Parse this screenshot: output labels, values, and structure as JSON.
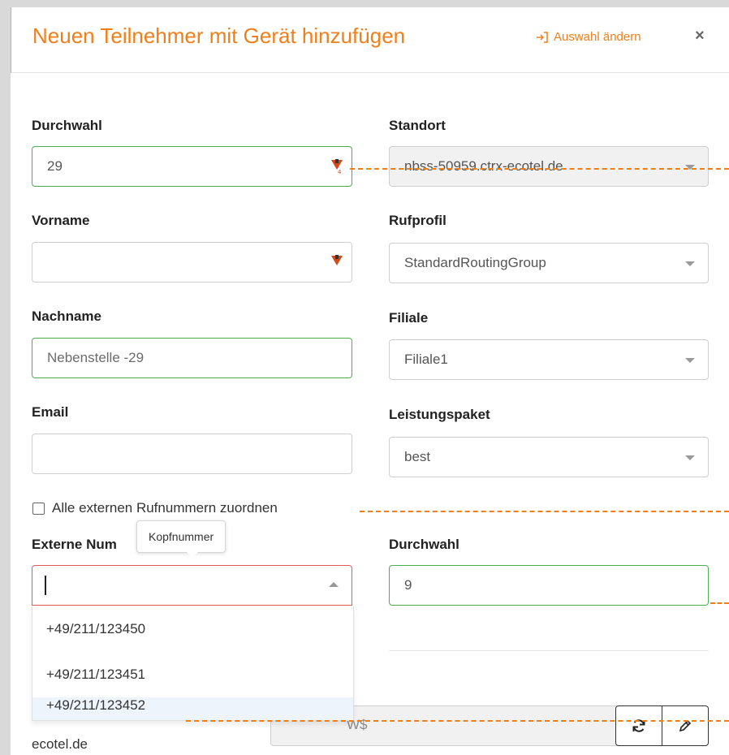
{
  "header": {
    "title": "Neuen Teilnehmer mit Gerät hinzufügen",
    "change_selection": "Auswahl ändern",
    "close": "×"
  },
  "form": {
    "durchwahl": {
      "label": "Durchwahl",
      "value": "29"
    },
    "standort": {
      "label": "Standort",
      "value": "nbss-50959.ctrx-ecotel.de"
    },
    "vorname": {
      "label": "Vorname",
      "value": ""
    },
    "rufprofil": {
      "label": "Rufprofil",
      "value": "StandardRoutingGroup"
    },
    "nachname": {
      "label": "Nachname",
      "placeholder": "Nebenstelle -29"
    },
    "filiale": {
      "label": "Filiale",
      "value": "Filiale1"
    },
    "email": {
      "label": "Email",
      "value": ""
    },
    "leistungspaket": {
      "label": "Leistungspaket",
      "value": "best"
    },
    "assign_all": {
      "label": "Alle externen Rufnummern zuordnen",
      "checked": false
    },
    "externe_nummer": {
      "label": "Externe Num",
      "value": "",
      "tooltip": "Kopfnummer",
      "options": [
        "+49/211/123450",
        "+49/211/123451",
        "+49/211/123452"
      ],
      "highlighted_index": 2
    },
    "durchwahl2": {
      "label": "Durchwahl",
      "value": "9"
    },
    "password_partial": "W$",
    "domain_partial": "ecotel.de"
  },
  "icons": {
    "refresh": "refresh-icon",
    "edit": "pencil-icon",
    "field_badge": "lastpass-badge-icon"
  },
  "colors": {
    "accent": "#f07f1a",
    "valid_border": "#4cae4c",
    "invalid_border": "#e05a5a"
  }
}
